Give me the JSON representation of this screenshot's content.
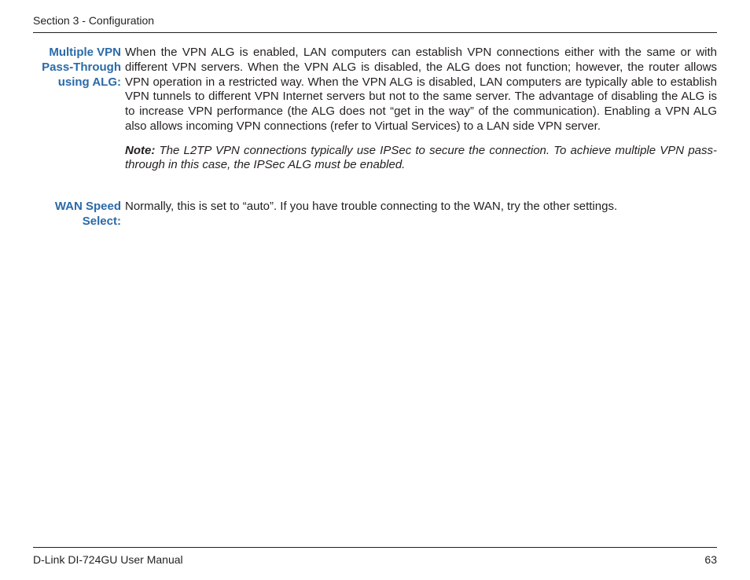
{
  "header": {
    "section": "Section 3 - Configuration"
  },
  "entries": [
    {
      "label": "Multiple VPN Pass-Through using ALG:",
      "body": "When the VPN ALG is enabled, LAN computers can establish VPN connections either with the same or with different VPN servers. When the VPN ALG is disabled, the ALG does not function; however, the router allows VPN operation in a restricted way. When the VPN ALG is disabled, LAN computers are typically able to establish VPN tunnels to different VPN Internet servers but not to the same server. The advantage of disabling the ALG is to increase VPN performance (the ALG does not “get in the way” of the communication). Enabling a VPN ALG also allows incoming VPN connections (refer to Virtual Services) to a LAN side VPN server.",
      "note_label": "Note:",
      "note_body": " The L2TP VPN connections typically use IPSec to secure the connection. To achieve multiple VPN pass-through in this case, the IPSec ALG must be enabled."
    },
    {
      "label": "WAN Speed Select:",
      "body": "Normally, this is set to “auto”. If you have trouble connecting to the WAN, try the other settings."
    }
  ],
  "footer": {
    "manual": "D-Link DI-724GU User Manual",
    "page": "63"
  }
}
